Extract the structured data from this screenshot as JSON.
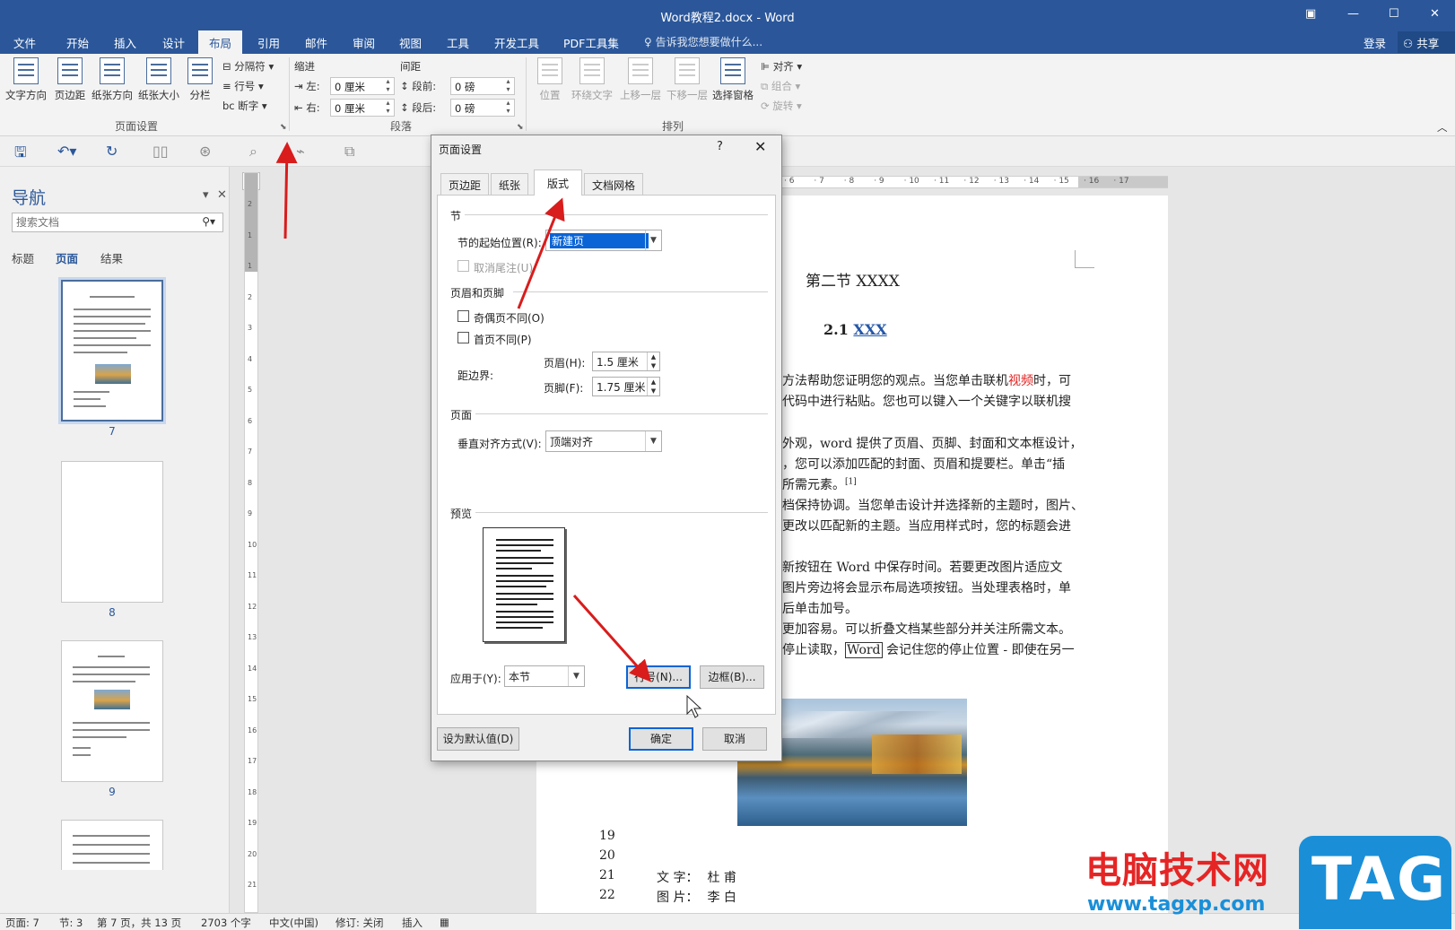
{
  "window": {
    "title": "Word教程2.docx - Word",
    "controls": [
      "▣",
      "—",
      "☐",
      "✕"
    ]
  },
  "tabs": [
    "文件",
    "开始",
    "插入",
    "设计",
    "布局",
    "引用",
    "邮件",
    "审阅",
    "视图",
    "工具",
    "开发工具",
    "PDF工具集"
  ],
  "active_tab": "布局",
  "tell_me": "告诉我您想要做什么...",
  "login": "登录",
  "share": "共享",
  "ribbon": {
    "page_setup": {
      "buttons": [
        "文字方向",
        "页边距",
        "纸张方向",
        "纸张大小",
        "分栏"
      ],
      "small": [
        "分隔符 ▾",
        "行号 ▾",
        "断字 ▾"
      ],
      "group_label": "页面设置"
    },
    "paragraph": {
      "indent_label": "缩进",
      "spacing_label": "间距",
      "left_label": "左:",
      "right_label": "右:",
      "before_label": "段前:",
      "after_label": "段后:",
      "left_value": "0 厘米",
      "right_value": "0 厘米",
      "before_value": "0 磅",
      "after_value": "0 磅",
      "group_label": "段落"
    },
    "arrange": {
      "buttons": [
        "位置",
        "环绕文字",
        "上移一层",
        "下移一层",
        "选择窗格"
      ],
      "small": [
        "对齐 ▾",
        "组合 ▾",
        "旋转 ▾"
      ],
      "group_label": "排列"
    }
  },
  "nav": {
    "title": "导航",
    "search_placeholder": "搜索文档",
    "tabs": [
      "标题",
      "页面",
      "结果"
    ],
    "active_tab": "页面",
    "pages": [
      "7",
      "8",
      "9"
    ]
  },
  "ruler": {
    "h_ticks": [
      "6",
      "7",
      "8",
      "9",
      "10",
      "11",
      "12",
      "13",
      "14",
      "15",
      "16",
      "17"
    ],
    "v_ticks": [
      "2",
      "1",
      "1",
      "2",
      "3",
      "4",
      "5",
      "6",
      "7",
      "8",
      "9",
      "10",
      "11",
      "12",
      "13",
      "14",
      "15",
      "16",
      "17",
      "18",
      "19",
      "20",
      "21"
    ],
    "corner": "L"
  },
  "document": {
    "heading": "第二节  XXXX",
    "sub_number": "2.1",
    "sub_link": "XXX",
    "lines": [
      {
        "pre": "方法帮助您证明您的观点。当您单击联机",
        "red": "视频",
        "post": "时，可"
      },
      {
        "pre": "代码中进行粘贴。您也可以键入一个关键字以联机搜",
        "red": "",
        "post": ""
      },
      {
        "pre": "外观，word 提供了页眉、页脚、封面和文本框设计，",
        "red": "",
        "post": ""
      },
      {
        "pre": "，您可以添加匹配的封面、页眉和提要栏。单击“插",
        "red": "",
        "post": ""
      },
      {
        "pre": "所需元素。",
        "red": "",
        "post": "[1]"
      },
      {
        "pre": "档保持协调。当您单击设计并选择新的主题时，图片、",
        "red": "",
        "post": ""
      },
      {
        "pre": "更改以匹配新的主题。当应用样式时，您的标题会进",
        "red": "",
        "post": ""
      },
      {
        "pre": "新按钮在 Word 中保存时间。若要更改图片适应文",
        "red": "",
        "post": ""
      },
      {
        "pre": "图片旁边将会显示布局选项按钮。当处理表格时，单",
        "red": "",
        "post": ""
      },
      {
        "pre": "后单击加号。",
        "red": "",
        "post": ""
      },
      {
        "pre": "更加容易。可以折叠文档某些部分并关注所需文本。",
        "red": "",
        "post": ""
      },
      {
        "pre": "停止读取，",
        "boxed": "Word",
        "post": " 会记住您的停止位置 - 即使在另一"
      }
    ],
    "line_numbers": [
      "19",
      "20",
      "21",
      "22"
    ],
    "credits": [
      {
        "label": "文 字：",
        "name": "杜    甫"
      },
      {
        "label": "图 片：",
        "name": "李    白"
      }
    ]
  },
  "dialog": {
    "title": "页面设置",
    "help": "?",
    "close": "✕",
    "tabs": [
      "页边距",
      "纸张",
      "版式",
      "文档网格"
    ],
    "active_tab": "版式",
    "section_label": "节",
    "section_start_label": "节的起始位置(R):",
    "section_start_value": "新建页",
    "suppress_endnotes": "取消尾注(U)",
    "headers_label": "页眉和页脚",
    "diff_odd_even": "奇偶页不同(O)",
    "diff_first": "首页不同(P)",
    "from_edge_label": "距边界:",
    "header_label": "页眉(H):",
    "header_value": "1.5 厘米",
    "footer_label": "页脚(F):",
    "footer_value": "1.75 厘米",
    "page_label": "页面",
    "valign_label": "垂直对齐方式(V):",
    "valign_value": "顶端对齐",
    "preview_label": "预览",
    "apply_label": "应用于(Y):",
    "apply_value": "本节",
    "line_numbers_btn": "行号(N)...",
    "borders_btn": "边框(B)...",
    "set_default_btn": "设为默认值(D)",
    "ok_btn": "确定",
    "cancel_btn": "取消"
  },
  "status": {
    "page": "页面: 7",
    "section": "节: 3",
    "of": "第 7 页，共 13 页",
    "words": "2703 个字",
    "lang": "中文(中国)",
    "track": "修订: 关闭",
    "insert": "插入"
  },
  "watermark": {
    "site": "电脑技术网",
    "url": "www.tagxp.com",
    "logo": "TAG"
  },
  "colors": {
    "word_blue": "#2b579a",
    "accent_red": "#e52525",
    "arrow_red": "#d91c1c",
    "watermark_blue": "#1a8fd8"
  }
}
